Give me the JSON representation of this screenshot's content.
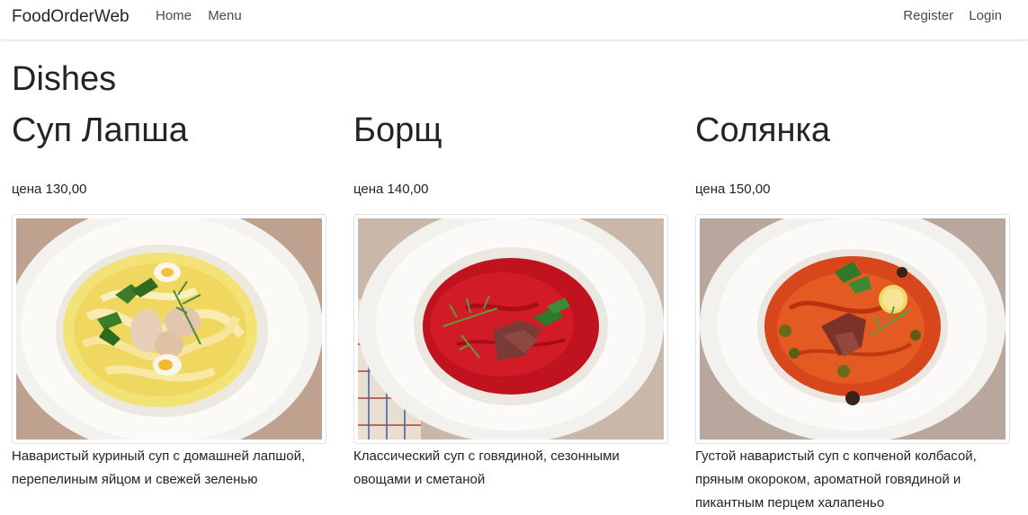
{
  "navbar": {
    "brand": "FoodOrderWeb",
    "links": [
      "Home",
      "Menu"
    ],
    "right_links": [
      "Register",
      "Login"
    ]
  },
  "page": {
    "title": "Dishes"
  },
  "dishes": [
    {
      "name": "Суп Лапша",
      "price": "цена 130,00",
      "description": "Наваристый куриный суп с домашней лапшой, перепелиным яйцом и свежей зеленью",
      "image": "noodle-soup-photo"
    },
    {
      "name": "Борщ",
      "price": "цена 140,00",
      "description": "Классический суп с говядиной, сезонными овощами и сметаной",
      "image": "borscht-photo"
    },
    {
      "name": "Солянка",
      "price": "цена 150,00",
      "description": "Густой наваристый суп с копченой колбасой, пряным окороком, ароматной говядиной и пикантным перцем халапеньо",
      "image": "solyanka-photo"
    }
  ]
}
